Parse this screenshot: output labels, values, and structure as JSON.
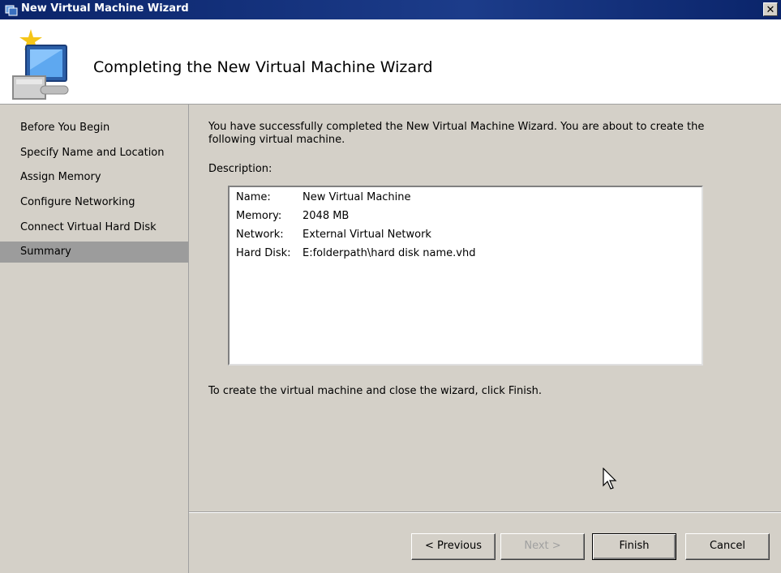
{
  "window": {
    "title": "New Virtual Machine Wizard",
    "close_glyph": "✕"
  },
  "header": {
    "heading": "Completing the New Virtual Machine Wizard"
  },
  "sidebar": {
    "items": [
      {
        "label": "Before You Begin"
      },
      {
        "label": "Specify Name and Location"
      },
      {
        "label": "Assign Memory"
      },
      {
        "label": "Configure Networking"
      },
      {
        "label": "Connect Virtual Hard Disk"
      },
      {
        "label": "Summary",
        "active": true
      }
    ]
  },
  "main": {
    "intro": "You have successfully completed the New Virtual Machine Wizard. You are about to create the following virtual machine.",
    "description_label": "Description:",
    "description": [
      {
        "key": "Name:",
        "value": "New Virtual Machine"
      },
      {
        "key": "Memory:",
        "value": "2048 MB"
      },
      {
        "key": "Network:",
        "value": "External Virtual Network"
      },
      {
        "key": "Hard Disk:",
        "value": "E:folderpath\\hard disk name.vhd"
      }
    ],
    "finish_note": "To create the virtual machine and close the wizard, click Finish."
  },
  "buttons": {
    "previous": "< Previous",
    "next": "Next >",
    "finish": "Finish",
    "cancel": "Cancel"
  },
  "colors": {
    "titlebar": "#0a246a",
    "selected_item": "#9c9c9c",
    "dialog_bg": "#d4d0c8"
  }
}
